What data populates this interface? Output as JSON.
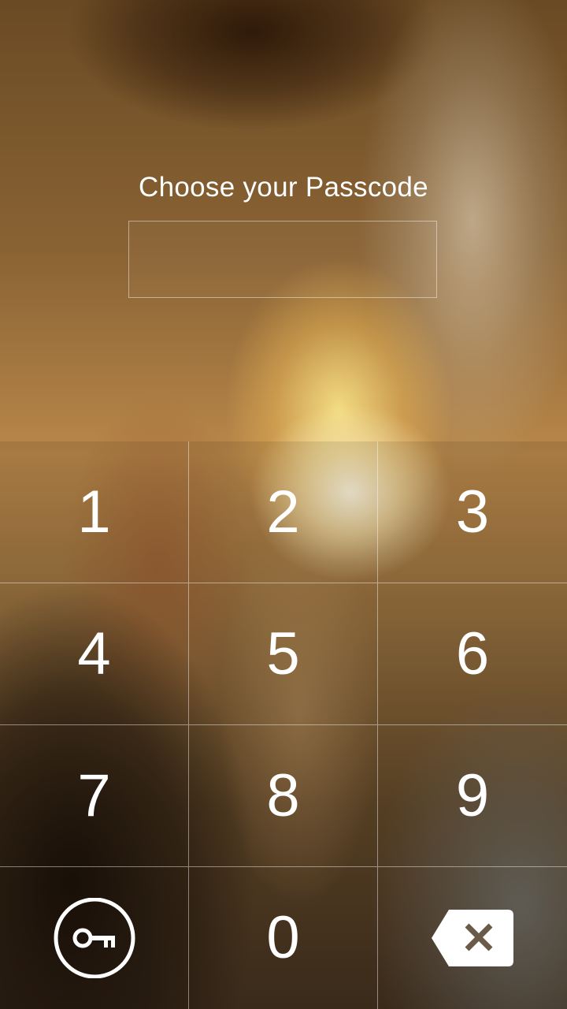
{
  "prompt": {
    "title": "Choose your Passcode"
  },
  "passcode_field": {
    "value": ""
  },
  "keypad": {
    "keys": [
      "1",
      "2",
      "3",
      "4",
      "5",
      "6",
      "7",
      "8",
      "9",
      "0"
    ],
    "left_action_icon": "key-icon",
    "right_action_icon": "backspace-icon"
  },
  "colors": {
    "text": "#ffffff",
    "grid_lines": "#ffffff"
  }
}
